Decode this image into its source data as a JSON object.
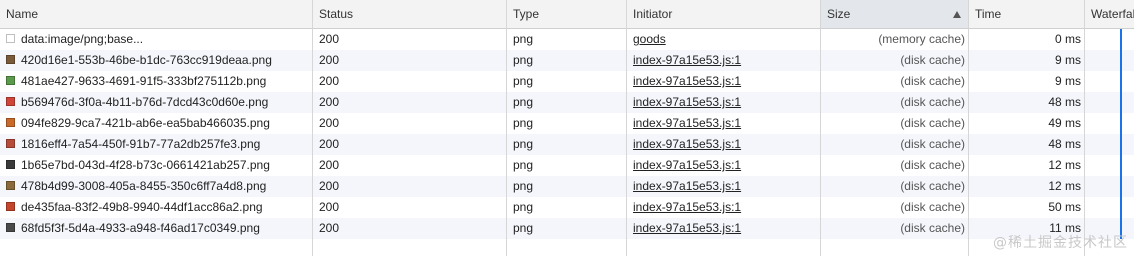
{
  "columns": {
    "name": "Name",
    "status": "Status",
    "type": "Type",
    "initiator": "Initiator",
    "size": "Size",
    "time": "Time",
    "waterfall": "Waterfall"
  },
  "rows": [
    {
      "name": "data:image/png;base...",
      "status": "200",
      "type": "png",
      "initiator": "goods",
      "size": "(memory cache)",
      "time": "0 ms",
      "icon_color": "#ffffff"
    },
    {
      "name": "420d16e1-553b-46be-b1dc-763cc919deaa.png",
      "status": "200",
      "type": "png",
      "initiator": "index-97a15e53.js:1",
      "size": "(disk cache)",
      "time": "9 ms",
      "icon_color": "#7b5a3a"
    },
    {
      "name": "481ae427-9633-4691-91f5-333bf275112b.png",
      "status": "200",
      "type": "png",
      "initiator": "index-97a15e53.js:1",
      "size": "(disk cache)",
      "time": "9 ms",
      "icon_color": "#5a9a4a"
    },
    {
      "name": "b569476d-3f0a-4b11-b76d-7dcd43c0d60e.png",
      "status": "200",
      "type": "png",
      "initiator": "index-97a15e53.js:1",
      "size": "(disk cache)",
      "time": "48 ms",
      "icon_color": "#d0453a"
    },
    {
      "name": "094fe829-9ca7-421b-ab6e-ea5bab466035.png",
      "status": "200",
      "type": "png",
      "initiator": "index-97a15e53.js:1",
      "size": "(disk cache)",
      "time": "49 ms",
      "icon_color": "#c96a2a"
    },
    {
      "name": "1816eff4-7a54-450f-91b7-77a2db257fe3.png",
      "status": "200",
      "type": "png",
      "initiator": "index-97a15e53.js:1",
      "size": "(disk cache)",
      "time": "48 ms",
      "icon_color": "#b84a3a"
    },
    {
      "name": "1b65e7bd-043d-4f28-b73c-0661421ab257.png",
      "status": "200",
      "type": "png",
      "initiator": "index-97a15e53.js:1",
      "size": "(disk cache)",
      "time": "12 ms",
      "icon_color": "#3a3a3a"
    },
    {
      "name": "478b4d99-3008-405a-8455-350c6ff7a4d8.png",
      "status": "200",
      "type": "png",
      "initiator": "index-97a15e53.js:1",
      "size": "(disk cache)",
      "time": "12 ms",
      "icon_color": "#8a6a3a"
    },
    {
      "name": "de435faa-83f2-49b8-9940-44df1acc86a2.png",
      "status": "200",
      "type": "png",
      "initiator": "index-97a15e53.js:1",
      "size": "(disk cache)",
      "time": "50 ms",
      "icon_color": "#c4452a"
    },
    {
      "name": "68fd5f3f-5d4a-4933-a948-f46ad17c0349.png",
      "status": "200",
      "type": "png",
      "initiator": "index-97a15e53.js:1",
      "size": "(disk cache)",
      "time": "11 ms",
      "icon_color": "#4a4a4a"
    }
  ],
  "watermark": "@稀土掘金技术社区",
  "colors": {
    "header_bg": "#f3f3f3",
    "sorted_header_bg": "#e3e6ea",
    "stripe_bg": "#f4f6fb",
    "waterfall_bar": "#1a73e8"
  }
}
